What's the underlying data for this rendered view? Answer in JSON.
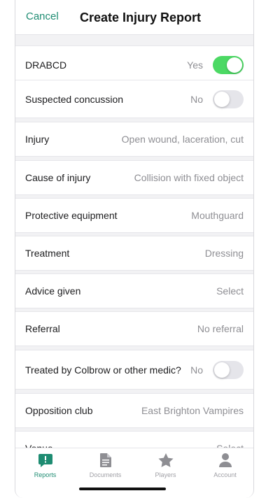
{
  "header": {
    "cancel_label": "Cancel",
    "title": "Create Injury Report"
  },
  "rows": [
    {
      "label": "DRABCD",
      "value": "Yes",
      "toggle": "on"
    },
    {
      "label": "Suspected concussion",
      "value": "No",
      "toggle": "off"
    },
    {
      "label": "Injury",
      "value": "Open wound, laceration, cut"
    },
    {
      "label": "Cause of injury",
      "value": "Collision with fixed object"
    },
    {
      "label": "Protective equipment",
      "value": "Mouthguard"
    },
    {
      "label": "Treatment",
      "value": "Dressing"
    },
    {
      "label": "Advice given",
      "value": "Select"
    },
    {
      "label": "Referral",
      "value": "No referral"
    },
    {
      "label": "Treated by Colbrow or other medic?",
      "value": "No",
      "toggle": "off"
    },
    {
      "label": "Opposition club",
      "value": "East Brighton Vampires"
    },
    {
      "label": "Venue",
      "value": "Select"
    }
  ],
  "tabs": [
    {
      "label": "Reports",
      "icon": "report-alert-icon",
      "active": true
    },
    {
      "label": "Documents",
      "icon": "document-icon",
      "active": false
    },
    {
      "label": "Players",
      "icon": "star-icon",
      "active": false
    },
    {
      "label": "Account",
      "icon": "person-icon",
      "active": false
    }
  ],
  "colors": {
    "accent": "#1e8c72",
    "toggle_on": "#4cd964",
    "toggle_off": "#e5e5ea",
    "secondary_text": "#8e8e93"
  }
}
